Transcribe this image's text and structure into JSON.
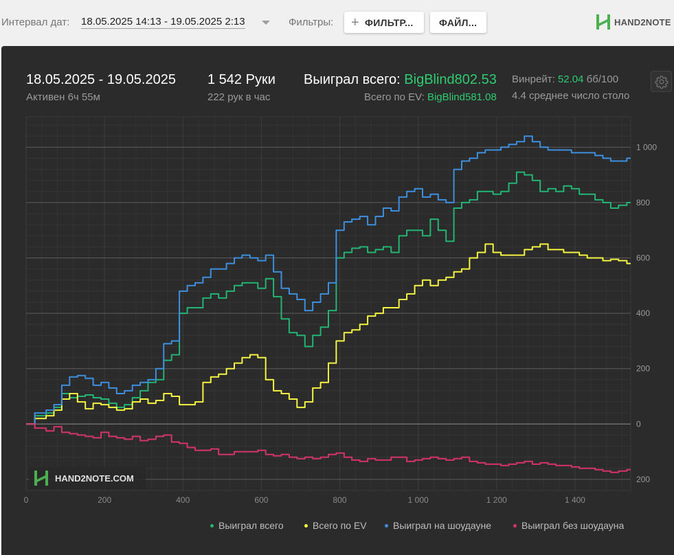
{
  "toolbar": {
    "interval_label": "Интервал дат:",
    "interval_value": "18.05.2025 14:13 - 19.05.2025 2:13",
    "filters_label": "Фильтры:",
    "filter_button": "ФИЛЬТР...",
    "file_button": "ФАЙЛ...",
    "logo_text": "HAND2NOTE"
  },
  "header": {
    "date_range": "18.05.2025 - 19.05.2025",
    "active": "Активен 6ч 55м",
    "hands": "1 542 Руки",
    "hands_per_hour": "222 рук в час",
    "won_label": "Выиграл всего:",
    "won_value": "BigBlind802.53",
    "ev_label": "Всего по EV:",
    "ev_value": "BigBlind581.08",
    "winrate_label": "Винрейт:",
    "winrate_value": "52.04",
    "winrate_unit": "бб/100",
    "tables": "4.4 среднее число столо"
  },
  "watermark": "HAND2NOTE.COM",
  "colors": {
    "won_total": "#22b573",
    "ev": "#f5f542",
    "showdown": "#3d8fe0",
    "non_showdown": "#d6336c",
    "panel_bg": "#2b2b2b"
  },
  "chart_data": {
    "type": "line",
    "x_ticks": [
      "0",
      "200",
      "400",
      "600",
      "800",
      "1 000",
      "1 200",
      "1 400"
    ],
    "x_tick_values": [
      0,
      200,
      400,
      600,
      800,
      1000,
      1200,
      1400
    ],
    "y_ticks": [
      "200",
      "0",
      "200",
      "400",
      "600",
      "800",
      "1 000"
    ],
    "y_tick_values": [
      -200,
      0,
      200,
      400,
      600,
      800,
      1000
    ],
    "xlim": [
      0,
      1542
    ],
    "ylim": [
      -240,
      1110
    ],
    "grid": true,
    "legend_position": "bottom",
    "series": [
      {
        "name": "Выиграл всего",
        "key": "won_total",
        "x": [
          0,
          40,
          60,
          80,
          100,
          120,
          140,
          160,
          180,
          200,
          220,
          240,
          260,
          280,
          300,
          320,
          340,
          360,
          380,
          400,
          420,
          440,
          460,
          480,
          500,
          520,
          540,
          560,
          580,
          600,
          620,
          640,
          660,
          680,
          700,
          720,
          740,
          760,
          780,
          800,
          820,
          840,
          860,
          880,
          900,
          920,
          940,
          960,
          980,
          1000,
          1020,
          1040,
          1060,
          1080,
          1100,
          1120,
          1140,
          1160,
          1180,
          1200,
          1220,
          1240,
          1260,
          1280,
          1300,
          1320,
          1340,
          1360,
          1380,
          1400,
          1420,
          1440,
          1460,
          1480,
          1500,
          1520,
          1542
        ],
        "y": [
          0,
          30,
          40,
          60,
          110,
          95,
          100,
          105,
          95,
          90,
          75,
          60,
          70,
          95,
          120,
          150,
          160,
          230,
          250,
          400,
          420,
          420,
          455,
          470,
          455,
          480,
          500,
          510,
          510,
          490,
          525,
          460,
          380,
          330,
          320,
          280,
          320,
          350,
          410,
          600,
          620,
          635,
          640,
          620,
          630,
          640,
          620,
          680,
          700,
          700,
          680,
          740,
          700,
          660,
          780,
          800,
          810,
          840,
          840,
          830,
          840,
          870,
          910,
          900,
          880,
          840,
          850,
          840,
          860,
          850,
          830,
          830,
          810,
          800,
          780,
          790,
          800
        ]
      },
      {
        "name": "Всего по EV",
        "key": "ev",
        "x": [
          0,
          40,
          60,
          80,
          100,
          120,
          140,
          160,
          180,
          200,
          220,
          240,
          260,
          280,
          300,
          320,
          340,
          360,
          380,
          400,
          420,
          440,
          460,
          480,
          500,
          520,
          540,
          560,
          580,
          600,
          620,
          640,
          660,
          680,
          700,
          720,
          740,
          760,
          780,
          800,
          820,
          840,
          860,
          880,
          900,
          920,
          940,
          960,
          980,
          1000,
          1020,
          1040,
          1060,
          1080,
          1100,
          1120,
          1140,
          1160,
          1180,
          1200,
          1220,
          1240,
          1260,
          1280,
          1300,
          1320,
          1340,
          1360,
          1380,
          1400,
          1420,
          1440,
          1460,
          1480,
          1500,
          1520,
          1542
        ],
        "y": [
          0,
          20,
          30,
          50,
          90,
          110,
          80,
          55,
          75,
          70,
          60,
          50,
          55,
          80,
          90,
          75,
          85,
          110,
          100,
          70,
          70,
          80,
          150,
          170,
          180,
          200,
          220,
          240,
          250,
          240,
          160,
          120,
          110,
          90,
          60,
          80,
          130,
          150,
          220,
          300,
          330,
          340,
          360,
          390,
          400,
          420,
          420,
          450,
          470,
          500,
          520,
          500,
          520,
          530,
          550,
          560,
          600,
          620,
          650,
          620,
          610,
          610,
          610,
          630,
          640,
          650,
          630,
          630,
          620,
          620,
          610,
          600,
          600,
          590,
          595,
          590,
          580
        ]
      },
      {
        "name": "Выиграл на шоудауне",
        "key": "showdown",
        "x": [
          0,
          40,
          60,
          80,
          100,
          120,
          140,
          160,
          180,
          200,
          220,
          240,
          260,
          280,
          300,
          320,
          340,
          360,
          380,
          400,
          420,
          440,
          460,
          480,
          500,
          520,
          540,
          560,
          580,
          600,
          620,
          640,
          660,
          680,
          700,
          720,
          740,
          760,
          780,
          800,
          820,
          840,
          860,
          880,
          900,
          920,
          940,
          960,
          980,
          1000,
          1020,
          1040,
          1060,
          1080,
          1100,
          1120,
          1140,
          1160,
          1180,
          1200,
          1220,
          1240,
          1260,
          1280,
          1300,
          1320,
          1340,
          1360,
          1380,
          1400,
          1420,
          1440,
          1460,
          1480,
          1500,
          1520,
          1542
        ],
        "y": [
          0,
          40,
          50,
          70,
          140,
          170,
          175,
          165,
          140,
          150,
          130,
          110,
          120,
          140,
          150,
          160,
          200,
          290,
          300,
          480,
          500,
          510,
          530,
          560,
          560,
          580,
          600,
          610,
          600,
          590,
          610,
          550,
          490,
          470,
          450,
          410,
          440,
          470,
          510,
          700,
          730,
          740,
          750,
          720,
          750,
          780,
          770,
          820,
          840,
          850,
          820,
          830,
          810,
          800,
          920,
          950,
          960,
          980,
          990,
          990,
          1000,
          1010,
          1020,
          1040,
          1020,
          1000,
          990,
          990,
          990,
          980,
          980,
          980,
          970,
          960,
          950,
          950,
          960
        ]
      },
      {
        "name": "Выиграл без шоудауна",
        "key": "non_showdown",
        "x": [
          0,
          40,
          60,
          80,
          100,
          120,
          140,
          160,
          180,
          200,
          220,
          240,
          260,
          280,
          300,
          320,
          340,
          360,
          380,
          400,
          420,
          440,
          460,
          480,
          500,
          520,
          540,
          560,
          580,
          600,
          620,
          640,
          660,
          680,
          700,
          720,
          740,
          760,
          780,
          800,
          820,
          840,
          860,
          880,
          900,
          920,
          940,
          960,
          980,
          1000,
          1020,
          1040,
          1060,
          1080,
          1100,
          1120,
          1140,
          1160,
          1180,
          1200,
          1220,
          1240,
          1260,
          1280,
          1300,
          1320,
          1340,
          1360,
          1380,
          1400,
          1420,
          1440,
          1460,
          1480,
          1500,
          1520,
          1542
        ],
        "y": [
          0,
          -15,
          -25,
          -10,
          -30,
          -35,
          -40,
          -45,
          -50,
          -30,
          -45,
          -50,
          -55,
          -45,
          -60,
          -55,
          -45,
          -40,
          -65,
          -70,
          -85,
          -95,
          -95,
          -90,
          -110,
          -110,
          -100,
          -100,
          -100,
          -95,
          -110,
          -115,
          -110,
          -120,
          -125,
          -120,
          -125,
          -120,
          -110,
          -105,
          -120,
          -130,
          -135,
          -125,
          -130,
          -130,
          -120,
          -120,
          -135,
          -130,
          -125,
          -120,
          -125,
          -130,
          -125,
          -120,
          -135,
          -140,
          -145,
          -145,
          -150,
          -145,
          -140,
          -135,
          -145,
          -140,
          -145,
          -150,
          -150,
          -155,
          -160,
          -160,
          -165,
          -170,
          -175,
          -170,
          -165
        ]
      }
    ]
  }
}
